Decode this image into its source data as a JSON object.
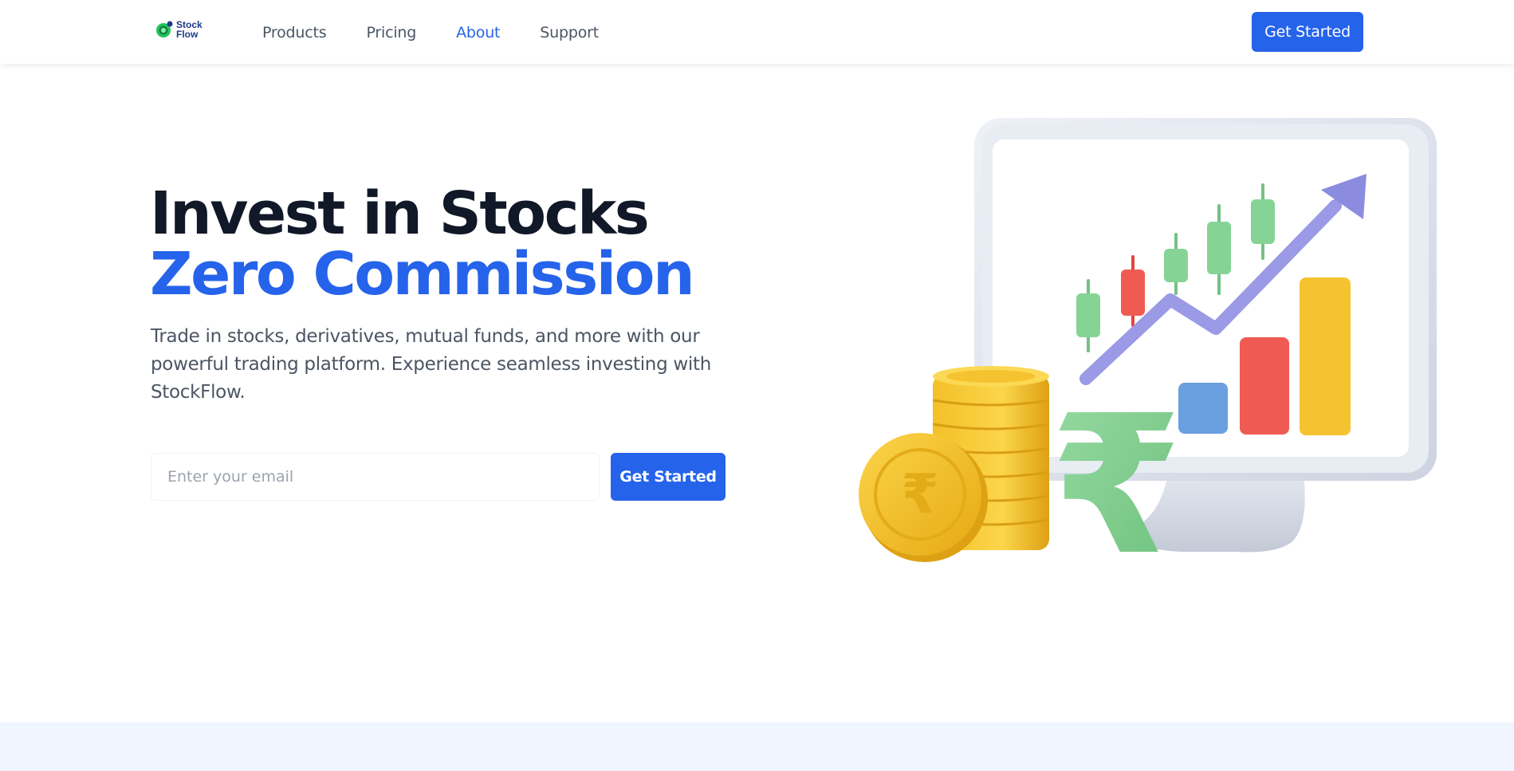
{
  "brand": {
    "logo_line1": "Stock",
    "logo_line2": "Flow"
  },
  "nav": {
    "items": [
      {
        "label": "Products",
        "active": false
      },
      {
        "label": "Pricing",
        "active": false
      },
      {
        "label": "About",
        "active": true
      },
      {
        "label": "Support",
        "active": false
      }
    ],
    "cta_label": "Get Started"
  },
  "hero": {
    "title_line1": "Invest in Stocks",
    "title_line2": "Zero Commission",
    "subtitle": "Trade in stocks, derivatives, mutual funds, and more with our powerful trading platform. Experience seamless investing with StockFlow.",
    "email_placeholder": "Enter your email",
    "email_value": "",
    "cta_label": "Get Started"
  },
  "illustration": {
    "icons": [
      "monitor-icon",
      "candlestick-chart-icon",
      "trend-arrow-icon",
      "bar-chart-icon",
      "coin-stack-icon",
      "rupee-coin-icon",
      "rupee-symbol-icon"
    ]
  },
  "colors": {
    "primary": "#2563eb",
    "heading": "#111827",
    "body": "#4b5563",
    "candle_green": "#86d495",
    "candle_red": "#ef5b52",
    "bar_blue": "#6a9fe0",
    "bar_red": "#ef5b52",
    "bar_yellow": "#f6c330",
    "arrow": "#9a9ae6",
    "coin": "#f6c330",
    "band": "#eff6ff"
  }
}
